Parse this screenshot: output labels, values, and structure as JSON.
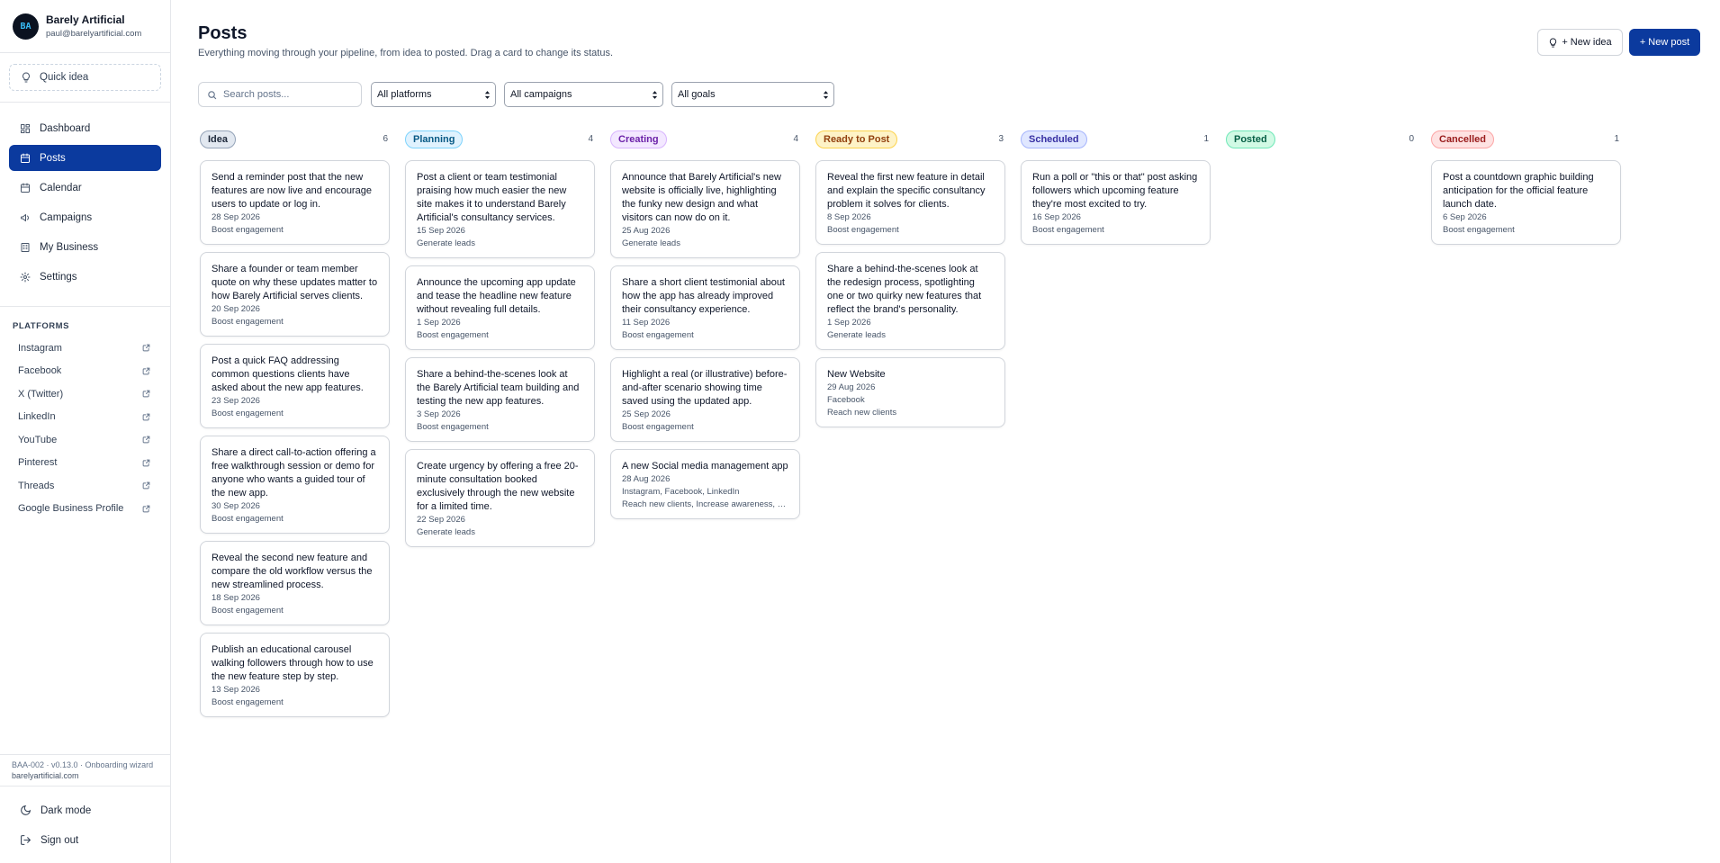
{
  "app": {
    "name": "Barely Artificial",
    "email": "paul@barelyartificial.com",
    "logo_letters": "BA"
  },
  "sidebar": {
    "quick_idea": "Quick idea",
    "nav": [
      {
        "label": "Dashboard",
        "icon": "dashboard-icon",
        "active": false
      },
      {
        "label": "Posts",
        "icon": "calendar-icon",
        "active": true
      },
      {
        "label": "Calendar",
        "icon": "calendar-icon",
        "active": false
      },
      {
        "label": "Campaigns",
        "icon": "megaphone-icon",
        "active": false
      },
      {
        "label": "My Business",
        "icon": "building-icon",
        "active": false
      },
      {
        "label": "Settings",
        "icon": "gear-icon",
        "active": false
      }
    ],
    "platforms_label": "PLATFORMS",
    "platforms": [
      "Instagram",
      "Facebook",
      "X (Twitter)",
      "LinkedIn",
      "YouTube",
      "Pinterest",
      "Threads",
      "Google Business Profile"
    ],
    "version": "BAA-002 · v0.13.0 · Onboarding wizard",
    "domain": "barelyartificial.com",
    "dark_mode": "Dark mode",
    "sign_out": "Sign out"
  },
  "header": {
    "title": "Posts",
    "subtitle": "Everything moving through your pipeline, from idea to posted. Drag a card to change its status.",
    "new_idea": "+ New idea",
    "new_post": "+ New post"
  },
  "filters": {
    "search_placeholder": "Search posts...",
    "platforms": "All platforms",
    "campaigns": "All campaigns",
    "goals": "All goals"
  },
  "columns": [
    {
      "label": "Idea",
      "count": "6",
      "color": {
        "bg": "#e2e8f0",
        "border": "#94a3b8",
        "text": "#1e293b"
      },
      "cards": [
        {
          "text": "Send a reminder post that the new features are now live and encourage users to update or log in.",
          "date": "28 Sep 2026",
          "meta": [
            "Boost engagement"
          ]
        },
        {
          "text": "Share a founder or team member quote on why these updates matter to how Barely Artificial serves clients.",
          "date": "20 Sep 2026",
          "meta": [
            "Boost engagement"
          ]
        },
        {
          "text": "Post a quick FAQ addressing common questions clients have asked about the new app features.",
          "date": "23 Sep 2026",
          "meta": [
            "Boost engagement"
          ]
        },
        {
          "text": "Share a direct call-to-action offering a free walkthrough session or demo for anyone who wants a guided tour of the new app.",
          "date": "30 Sep 2026",
          "meta": [
            "Boost engagement"
          ]
        },
        {
          "text": "Reveal the second new feature and compare the old workflow versus the new streamlined process.",
          "date": "18 Sep 2026",
          "meta": [
            "Boost engagement"
          ]
        },
        {
          "text": "Publish an educational carousel walking followers through how to use the new feature step by step.",
          "date": "13 Sep 2026",
          "meta": [
            "Boost engagement"
          ]
        }
      ]
    },
    {
      "label": "Planning",
      "count": "4",
      "color": {
        "bg": "#e0f2fe",
        "border": "#7dd3fc",
        "text": "#075985"
      },
      "cards": [
        {
          "text": "Post a client or team testimonial praising how much easier the new site makes it to understand Barely Artificial's consultancy services.",
          "date": "15 Sep 2026",
          "meta": [
            "Generate leads"
          ]
        },
        {
          "text": "Announce the upcoming app update and tease the headline new feature without revealing full details.",
          "date": "1 Sep 2026",
          "meta": [
            "Boost engagement"
          ]
        },
        {
          "text": "Share a behind-the-scenes look at the Barely Artificial team building and testing the new app features.",
          "date": "3 Sep 2026",
          "meta": [
            "Boost engagement"
          ]
        },
        {
          "text": "Create urgency by offering a free 20-minute consultation booked exclusively through the new website for a limited time.",
          "date": "22 Sep 2026",
          "meta": [
            "Generate leads"
          ]
        }
      ]
    },
    {
      "label": "Creating",
      "count": "4",
      "color": {
        "bg": "#f3e8ff",
        "border": "#d8b4fe",
        "text": "#6b21a8"
      },
      "cards": [
        {
          "text": "Announce that Barely Artificial's new website is officially live, highlighting the funky new design and what visitors can now do on it.",
          "date": "25 Aug 2026",
          "meta": [
            "Generate leads"
          ]
        },
        {
          "text": "Share a short client testimonial about how the app has already improved their consultancy experience.",
          "date": "11 Sep 2026",
          "meta": [
            "Boost engagement"
          ]
        },
        {
          "text": "Highlight a real (or illustrative) before-and-after scenario showing time saved using the updated app.",
          "date": "25 Sep 2026",
          "meta": [
            "Boost engagement"
          ]
        },
        {
          "text": "A new Social media management app",
          "date": "28 Aug 2026",
          "meta": [
            "Instagram, Facebook, LinkedIn",
            "Reach new clients, Increase awareness, Ed..."
          ]
        }
      ]
    },
    {
      "label": "Ready to Post",
      "count": "3",
      "color": {
        "bg": "#fef3c7",
        "border": "#fcd34d",
        "text": "#92400e"
      },
      "cards": [
        {
          "text": "Reveal the first new feature in detail and explain the specific consultancy problem it solves for clients.",
          "date": "8 Sep 2026",
          "meta": [
            "Boost engagement"
          ]
        },
        {
          "text": "Share a behind-the-scenes look at the redesign process, spotlighting one or two quirky new features that reflect the brand's personality.",
          "date": "1 Sep 2026",
          "meta": [
            "Generate leads"
          ]
        },
        {
          "text": "New Website",
          "date": "29 Aug 2026",
          "meta": [
            "Facebook",
            "Reach new clients"
          ]
        }
      ]
    },
    {
      "label": "Scheduled",
      "count": "1",
      "color": {
        "bg": "#e0e7ff",
        "border": "#a5b4fc",
        "text": "#3730a3"
      },
      "cards": [
        {
          "text": "Run a poll or \"this or that\" post asking followers which upcoming feature they're most excited to try.",
          "date": "16 Sep 2026",
          "meta": [
            "Boost engagement"
          ]
        }
      ]
    },
    {
      "label": "Posted",
      "count": "0",
      "color": {
        "bg": "#d1fae5",
        "border": "#6ee7b7",
        "text": "#065f46"
      },
      "cards": []
    },
    {
      "label": "Cancelled",
      "count": "1",
      "color": {
        "bg": "#fee2e2",
        "border": "#fca5a5",
        "text": "#991b1b"
      },
      "cards": [
        {
          "text": "Post a countdown graphic building anticipation for the official feature launch date.",
          "date": "6 Sep 2026",
          "meta": [
            "Boost engagement"
          ]
        }
      ]
    }
  ]
}
